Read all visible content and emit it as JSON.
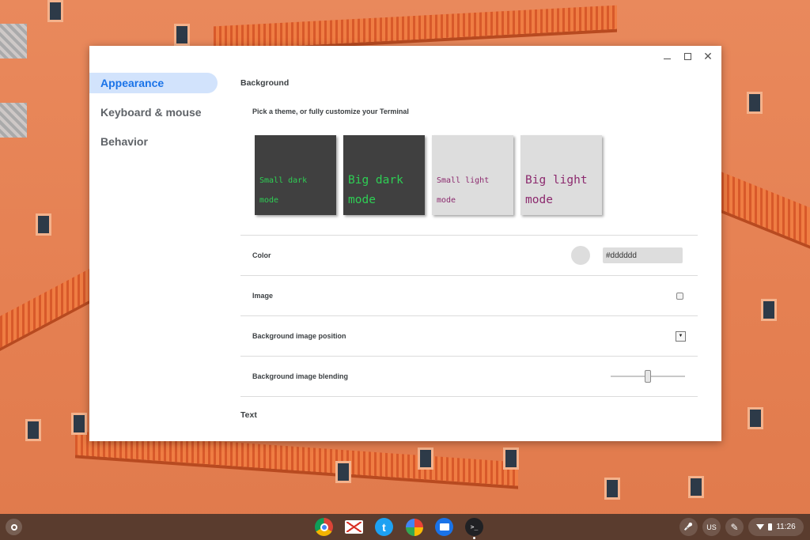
{
  "window": {
    "minimize_label": "",
    "maximize_label": "",
    "close_label": "✕"
  },
  "sidebar": {
    "items": [
      {
        "label": "Appearance",
        "active": true
      },
      {
        "label": "Keyboard & mouse",
        "active": false
      },
      {
        "label": "Behavior",
        "active": false
      }
    ]
  },
  "background_section": {
    "title": "Background",
    "subtitle": "Pick a theme, or fully customize your Terminal",
    "themes": [
      {
        "line1": "Small dark",
        "line2": "mode"
      },
      {
        "line1": "Big dark",
        "line2": "mode"
      },
      {
        "line1": "Small light",
        "line2": "mode"
      },
      {
        "line1": "Big light",
        "line2": "mode"
      }
    ],
    "rows": {
      "color": {
        "label": "Color",
        "value": "#dddddd",
        "swatch": "#dddddd"
      },
      "image": {
        "label": "Image",
        "checked": false
      },
      "position": {
        "label": "Background image position",
        "select_glyph": "▼"
      },
      "blending": {
        "label": "Background image blending",
        "value_percent": 50
      }
    }
  },
  "text_section": {
    "title": "Text"
  },
  "shelf": {
    "apps": [
      "chrome-icon",
      "gmail-icon",
      "twitter-icon",
      "google-photos-icon",
      "files-icon",
      "terminal-icon"
    ],
    "terminal_glyph": ">_",
    "twitter_glyph": "t",
    "tray": {
      "microphone_glyph": "🎤",
      "keyboard_layout": "US",
      "stylus_glyph": "✎",
      "time": "11:26"
    }
  },
  "colors": {
    "accent": "#1a73e8",
    "active_nav_bg": "#d2e3fc",
    "dark_theme_bg": "#404040",
    "dark_theme_fg": "#2ece54",
    "light_theme_bg": "#dddddd",
    "light_theme_fg": "#8c2a6e"
  }
}
